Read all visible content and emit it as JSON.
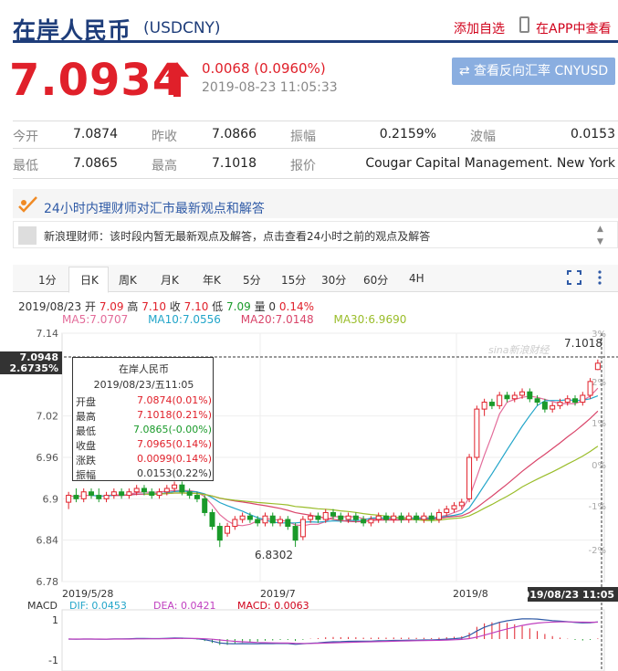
{
  "header": {
    "title": "在岸人民币",
    "code": "(USDCNY)",
    "add_watch": "添加自选",
    "app_link": "在APP中查看"
  },
  "quote": {
    "price": "7.0934",
    "change": "0.0068 (0.0960%)",
    "time": "2019-08-23 11:05:33",
    "reverse_btn": "⇄ 查看反向汇率 CNYUSD",
    "color_up": "#e0202a"
  },
  "stats": [
    {
      "label": "今开",
      "value": "7.0874"
    },
    {
      "label": "昨收",
      "value": "7.0866"
    },
    {
      "label": "振幅",
      "value": "0.2159%"
    },
    {
      "label": "波幅",
      "value": "0.0153"
    },
    {
      "label": "最低",
      "value": "7.0865"
    },
    {
      "label": "最高",
      "value": "7.1018"
    },
    {
      "label": "报价",
      "value": "Cougar Capital Management. New York"
    }
  ],
  "advisor": {
    "title": "24小时内理财师对汇市最新观点和解答",
    "notice": "新浪理财师：该时段内暂无最新观点及解答，点击查看24小时之前的观点及解答"
  },
  "tabs": [
    "1分",
    "日K",
    "周K",
    "月K",
    "年K",
    "5分",
    "15分",
    "30分",
    "60分",
    "4H"
  ],
  "active_tab": "日K",
  "ohlc_line": {
    "date": "2019/08/23",
    "o_label": "开",
    "o": "7.09",
    "h_label": "高",
    "h": "7.10",
    "c_label": "收",
    "c": "7.10",
    "l_label": "低",
    "l": "7.09",
    "vol_label": "量",
    "vol": "0",
    "pct": "0.14%"
  },
  "ma": [
    {
      "name": "MA5:",
      "value": "7.0707",
      "color": "#e36c9a"
    },
    {
      "name": "MA10:",
      "value": "7.0556",
      "color": "#22a5c9"
    },
    {
      "name": "MA20:",
      "value": "7.0148",
      "color": "#d9456a"
    },
    {
      "name": "MA30:",
      "value": "6.9690",
      "color": "#9abd2a"
    }
  ],
  "tooltip": {
    "title": "在岸人民币",
    "date": "2019/08/23/五11:05",
    "rows": [
      {
        "k": "开盘",
        "v": "7.0874(0.01%)",
        "c": "r"
      },
      {
        "k": "最高",
        "v": "7.1018(0.21%)",
        "c": "r"
      },
      {
        "k": "最低",
        "v": "7.0865(-0.00%)",
        "c": "g"
      },
      {
        "k": "收盘",
        "v": "7.0965(0.14%)",
        "c": "r"
      },
      {
        "k": "涨跌",
        "v": "0.0099(0.14%)",
        "c": "r"
      },
      {
        "k": "振幅",
        "v": "0.0153(0.22%)",
        "c": "b"
      }
    ]
  },
  "chart_data": {
    "type": "candlestick",
    "yticks": [
      "7.14",
      "7.02",
      "6.96",
      "6.9",
      "6.84",
      "6.78"
    ],
    "pct_ticks": [
      "3%",
      "2%",
      "1%",
      "0%",
      "-1%",
      "-2%"
    ],
    "x_labels": [
      "2019/5/28",
      "2019/7",
      "2019/8"
    ],
    "current_label": "7.0948",
    "current_pct": "2.6735%",
    "crosshair_date": "2019/08/23 11:05",
    "max_label": "7.1018",
    "min_label": "6.8302",
    "watermark": "sina新浪财经",
    "ylim": [
      6.78,
      7.14
    ],
    "candles": [
      [
        6.895,
        6.905,
        6.885,
        6.91
      ],
      [
        6.905,
        6.9,
        6.895,
        6.915
      ],
      [
        6.9,
        6.91,
        6.895,
        6.915
      ],
      [
        6.91,
        6.905,
        6.9,
        6.915
      ],
      [
        6.905,
        6.9,
        6.895,
        6.915
      ],
      [
        6.9,
        6.905,
        6.895,
        6.91
      ],
      [
        6.905,
        6.91,
        6.9,
        6.915
      ],
      [
        6.91,
        6.905,
        6.9,
        6.915
      ],
      [
        6.905,
        6.91,
        6.9,
        6.915
      ],
      [
        6.91,
        6.915,
        6.905,
        6.92
      ],
      [
        6.915,
        6.91,
        6.905,
        6.92
      ],
      [
        6.91,
        6.905,
        6.9,
        6.915
      ],
      [
        6.905,
        6.91,
        6.9,
        6.915
      ],
      [
        6.91,
        6.915,
        6.905,
        6.92
      ],
      [
        6.915,
        6.92,
        6.91,
        6.925
      ],
      [
        6.92,
        6.91,
        6.905,
        6.925
      ],
      [
        6.91,
        6.905,
        6.9,
        6.915
      ],
      [
        6.905,
        6.9,
        6.895,
        6.91
      ],
      [
        6.9,
        6.88,
        6.875,
        6.905
      ],
      [
        6.88,
        6.86,
        6.855,
        6.885
      ],
      [
        6.86,
        6.84,
        6.83,
        6.865
      ],
      [
        6.85,
        6.86,
        6.845,
        6.865
      ],
      [
        6.86,
        6.87,
        6.855,
        6.875
      ],
      [
        6.87,
        6.875,
        6.865,
        6.88
      ],
      [
        6.875,
        6.87,
        6.865,
        6.88
      ],
      [
        6.87,
        6.865,
        6.86,
        6.875
      ],
      [
        6.865,
        6.875,
        6.86,
        6.88
      ],
      [
        6.875,
        6.865,
        6.86,
        6.88
      ],
      [
        6.865,
        6.87,
        6.86,
        6.875
      ],
      [
        6.87,
        6.86,
        6.855,
        6.875
      ],
      [
        6.86,
        6.84,
        6.8302,
        6.865
      ],
      [
        6.845,
        6.87,
        6.84,
        6.875
      ],
      [
        6.87,
        6.875,
        6.865,
        6.88
      ],
      [
        6.875,
        6.87,
        6.865,
        6.88
      ],
      [
        6.87,
        6.88,
        6.865,
        6.885
      ],
      [
        6.88,
        6.875,
        6.87,
        6.885
      ],
      [
        6.875,
        6.87,
        6.865,
        6.88
      ],
      [
        6.87,
        6.875,
        6.865,
        6.88
      ],
      [
        6.875,
        6.87,
        6.865,
        6.88
      ],
      [
        6.87,
        6.865,
        6.86,
        6.875
      ],
      [
        6.865,
        6.87,
        6.86,
        6.875
      ],
      [
        6.87,
        6.875,
        6.865,
        6.88
      ],
      [
        6.875,
        6.87,
        6.865,
        6.88
      ],
      [
        6.87,
        6.875,
        6.865,
        6.88
      ],
      [
        6.875,
        6.87,
        6.865,
        6.88
      ],
      [
        6.87,
        6.875,
        6.865,
        6.88
      ],
      [
        6.875,
        6.87,
        6.865,
        6.88
      ],
      [
        6.87,
        6.875,
        6.865,
        6.88
      ],
      [
        6.875,
        6.87,
        6.865,
        6.88
      ],
      [
        6.87,
        6.88,
        6.865,
        6.885
      ],
      [
        6.88,
        6.885,
        6.875,
        6.89
      ],
      [
        6.885,
        6.89,
        6.88,
        6.895
      ],
      [
        6.89,
        6.895,
        6.885,
        6.9
      ],
      [
        6.9,
        6.96,
        6.895,
        6.965
      ],
      [
        6.96,
        7.03,
        6.955,
        7.035
      ],
      [
        7.03,
        7.04,
        7.02,
        7.045
      ],
      [
        7.04,
        7.035,
        7.03,
        7.045
      ],
      [
        7.035,
        7.05,
        7.03,
        7.055
      ],
      [
        7.05,
        7.045,
        7.04,
        7.055
      ],
      [
        7.045,
        7.05,
        7.04,
        7.055
      ],
      [
        7.05,
        7.055,
        7.045,
        7.06
      ],
      [
        7.055,
        7.045,
        7.04,
        7.06
      ],
      [
        7.045,
        7.04,
        7.035,
        7.05
      ],
      [
        7.04,
        7.03,
        7.025,
        7.045
      ],
      [
        7.03,
        7.035,
        7.025,
        7.04
      ],
      [
        7.035,
        7.04,
        7.03,
        7.045
      ],
      [
        7.04,
        7.045,
        7.035,
        7.05
      ],
      [
        7.045,
        7.04,
        7.035,
        7.05
      ],
      [
        7.04,
        7.05,
        7.035,
        7.055
      ],
      [
        7.05,
        7.07,
        7.045,
        7.075
      ],
      [
        7.0874,
        7.0965,
        7.0865,
        7.1018
      ]
    ],
    "macd": {
      "dif": "0.0453",
      "dea": "0.0421",
      "macd": "0.0063",
      "dif_label": "DIF:",
      "dea_label": "DEA:",
      "macd_label": "MACD:",
      "name": "MACD",
      "yticks": [
        "1",
        "-1"
      ]
    }
  }
}
